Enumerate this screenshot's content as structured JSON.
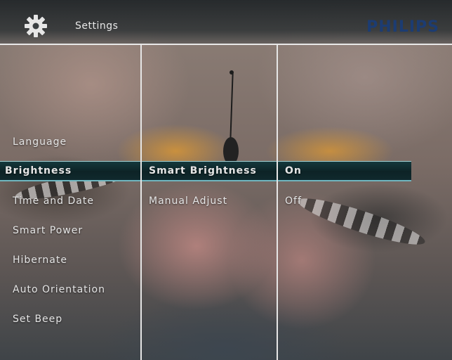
{
  "header": {
    "title": "Settings",
    "brand": "PHILIPS"
  },
  "menu_column_1": [
    {
      "label": "Language"
    },
    {
      "label": "Brightness",
      "selected": true
    },
    {
      "label": "Time and Date"
    },
    {
      "label": "Smart Power"
    },
    {
      "label": "Hibernate"
    },
    {
      "label": "Auto Orientation"
    },
    {
      "label": "Set Beep"
    }
  ],
  "menu_column_2": [
    {
      "label": "Smart Brightness",
      "selected": true
    },
    {
      "label": "Manual Adjust"
    }
  ],
  "menu_column_3": [
    {
      "label": "On",
      "selected": true
    },
    {
      "label": "Off"
    }
  ],
  "colors": {
    "highlight": "#0d2326",
    "highlight_border": "#6fb6bf",
    "brand": "#1c3c72",
    "text": "#e6e6e6"
  },
  "icons": {
    "settings": "gear-icon"
  }
}
